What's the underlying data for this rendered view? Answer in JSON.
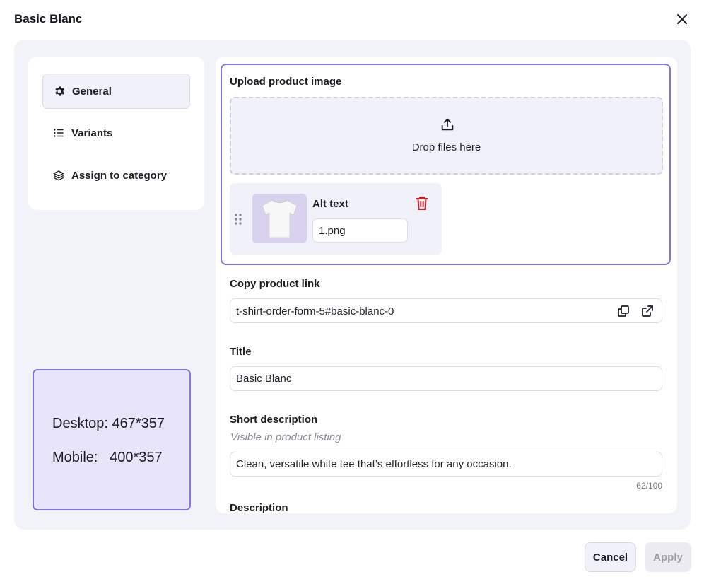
{
  "modal": {
    "title": "Basic Blanc",
    "close_icon": "close-icon"
  },
  "sidebar": {
    "items": [
      {
        "label": "General",
        "icon": "gear-icon",
        "active": true
      },
      {
        "label": "Variants",
        "icon": "list-icon",
        "active": false
      },
      {
        "label": "Assign to category",
        "icon": "layers-icon",
        "active": false
      }
    ]
  },
  "dimensions": {
    "desktop": "Desktop: 467*357",
    "mobile": "Mobile:   400*357"
  },
  "upload": {
    "label": "Upload product image",
    "drop_text": "Drop files here",
    "image": {
      "alt_label": "Alt text",
      "alt_value": "1.png"
    }
  },
  "product_link": {
    "label": "Copy product link",
    "value": "t-shirt-order-form-5#basic-blanc-0"
  },
  "title_field": {
    "label": "Title",
    "value": "Basic Blanc"
  },
  "short_description": {
    "label": "Short description",
    "hint": "Visible in product listing",
    "value": "Clean, versatile white tee that’s effortless for any occasion.",
    "counter": "62/100"
  },
  "description": {
    "label": "Description"
  },
  "footer": {
    "cancel_label": "Cancel",
    "apply_label": "Apply"
  },
  "colors": {
    "accent": "#8276dc",
    "panel_bg": "#f2f2f9",
    "delete": "#c8232c"
  }
}
